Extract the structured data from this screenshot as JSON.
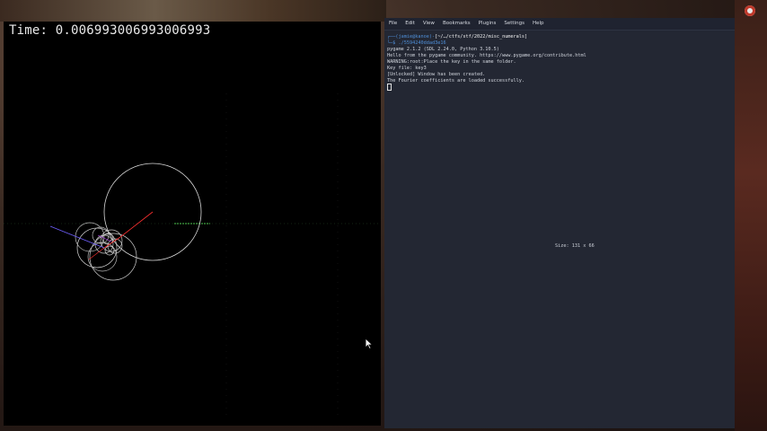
{
  "game": {
    "time_text": "Time: 0.006993006993006993"
  },
  "terminal": {
    "menu": [
      "File",
      "Edit",
      "View",
      "Bookmarks",
      "Plugins",
      "Settings",
      "Help"
    ],
    "prompt_user": "(jamie@kanoe)",
    "prompt_sep": "-",
    "prompt_path": "[~/…/ctfs/stf/2022/misc_numerals]",
    "command_prefix": "└─$ ",
    "command": "./5594240ddad3e16",
    "lines": [
      "pygame 2.1.2 (SDL 2.24.0, Python 3.10.5)",
      "Hello from the pygame community. https://www.pygame.org/contribute.html",
      "WARNING:root:Place the key in the same folder.",
      "Key file: key3",
      "[Unlocked] Window has been created.",
      "The Fourier coefficients are loaded successfully."
    ],
    "size_label": "Size: 131 x 66"
  }
}
